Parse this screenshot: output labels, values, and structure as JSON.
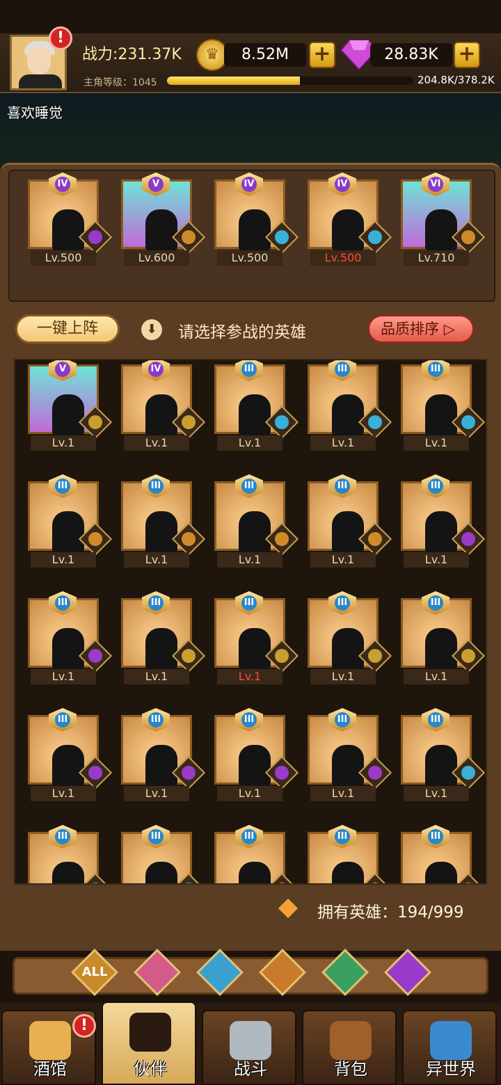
{
  "header": {
    "power_label": "战力:231.37K",
    "gold_value": "8.52M",
    "gem_value": "28.83K",
    "level_label": "主角等级：1045",
    "xp_text": "204.8K/378.2K",
    "xp_progress": 0.54,
    "player_name": "喜欢睡觉",
    "alert_mark": "!"
  },
  "lineup": {
    "heroes": [
      {
        "rank": "IV",
        "level": "Lv.500",
        "faction": "demon",
        "bg": "normal"
      },
      {
        "rank": "V",
        "level": "Lv.600",
        "faction": "beast",
        "bg": "teal"
      },
      {
        "rank": "IV",
        "level": "Lv.500",
        "faction": "goblin",
        "bg": "normal"
      },
      {
        "rank": "IV",
        "level": "Lv.500",
        "faction": "goblin",
        "bg": "normal",
        "level_color": "red"
      },
      {
        "rank": "VI",
        "level": "Lv.710",
        "faction": "beast",
        "bg": "teal"
      }
    ]
  },
  "actions": {
    "auto_deploy": "一键上阵",
    "hint": "请选择参战的英雄",
    "sort": "品质排序",
    "info_icon": "download-circle-icon"
  },
  "roster": {
    "rows": [
      [
        {
          "rank": "V",
          "level": "Lv.1",
          "faction": "human",
          "bg": "teal"
        },
        {
          "rank": "IV",
          "level": "Lv.1",
          "faction": "human",
          "bg": "normal"
        },
        {
          "rank": "III",
          "level": "Lv.1",
          "faction": "goblin",
          "bg": "normal"
        },
        {
          "rank": "III",
          "level": "Lv.1",
          "faction": "goblin",
          "bg": "normal"
        },
        {
          "rank": "III",
          "level": "Lv.1",
          "faction": "goblin",
          "bg": "normal"
        }
      ],
      [
        {
          "rank": "III",
          "level": "Lv.1",
          "faction": "beast",
          "bg": "normal"
        },
        {
          "rank": "III",
          "level": "Lv.1",
          "faction": "beast",
          "bg": "normal"
        },
        {
          "rank": "III",
          "level": "Lv.1",
          "faction": "beast",
          "bg": "normal"
        },
        {
          "rank": "III",
          "level": "Lv.1",
          "faction": "beast",
          "bg": "normal"
        },
        {
          "rank": "III",
          "level": "Lv.1",
          "faction": "demon",
          "bg": "normal"
        }
      ],
      [
        {
          "rank": "III",
          "level": "Lv.1",
          "faction": "demon",
          "bg": "normal"
        },
        {
          "rank": "III",
          "level": "Lv.1",
          "faction": "human",
          "bg": "normal"
        },
        {
          "rank": "III",
          "level": "Lv.1",
          "faction": "human",
          "bg": "normal",
          "level_color": "red"
        },
        {
          "rank": "III",
          "level": "Lv.1",
          "faction": "human",
          "bg": "normal"
        },
        {
          "rank": "III",
          "level": "Lv.1",
          "faction": "human",
          "bg": "normal"
        }
      ],
      [
        {
          "rank": "III",
          "level": "Lv.1",
          "faction": "demon",
          "bg": "normal"
        },
        {
          "rank": "III",
          "level": "Lv.1",
          "faction": "demon",
          "bg": "normal"
        },
        {
          "rank": "III",
          "level": "Lv.1",
          "faction": "demon",
          "bg": "normal"
        },
        {
          "rank": "III",
          "level": "Lv.1",
          "faction": "demon",
          "bg": "normal"
        },
        {
          "rank": "III",
          "level": "Lv.1",
          "faction": "goblin",
          "bg": "normal"
        }
      ],
      [
        {
          "rank": "III",
          "level": "",
          "faction": "goblin",
          "bg": "normal"
        },
        {
          "rank": "III",
          "level": "",
          "faction": "goblin",
          "bg": "normal"
        },
        {
          "rank": "III",
          "level": "",
          "faction": "human",
          "bg": "normal"
        },
        {
          "rank": "III",
          "level": "",
          "faction": "human",
          "bg": "normal"
        },
        {
          "rank": "III",
          "level": "",
          "faction": "human",
          "bg": "normal"
        }
      ]
    ],
    "owned_text": "拥有英雄：194/999"
  },
  "filters": {
    "items": [
      {
        "name": "all",
        "label": "ALL",
        "color": "#c98a2a"
      },
      {
        "name": "human",
        "label": "",
        "color": "#d45a8a"
      },
      {
        "name": "goblin",
        "label": "",
        "color": "#3aa0d0"
      },
      {
        "name": "beast",
        "label": "",
        "color": "#c97a2a"
      },
      {
        "name": "elf",
        "label": "",
        "color": "#3aa060"
      },
      {
        "name": "demon",
        "label": "",
        "color": "#9a3ac9"
      }
    ]
  },
  "nav": {
    "items": [
      {
        "label": "酒馆",
        "icon": "beer-mug-icon",
        "active": false,
        "alert": "!"
      },
      {
        "label": "伙伴",
        "icon": "partner-icon",
        "active": true
      },
      {
        "label": "战斗",
        "icon": "crossed-swords-icon",
        "active": false
      },
      {
        "label": "背包",
        "icon": "backpack-icon",
        "active": false
      },
      {
        "label": "异世界",
        "icon": "portal-icon",
        "active": false
      }
    ]
  },
  "colors": {
    "faction_demon": "#9a3ac9",
    "faction_beast": "#d08a2a",
    "faction_goblin": "#3ab0d8",
    "faction_human": "#c9a030"
  }
}
